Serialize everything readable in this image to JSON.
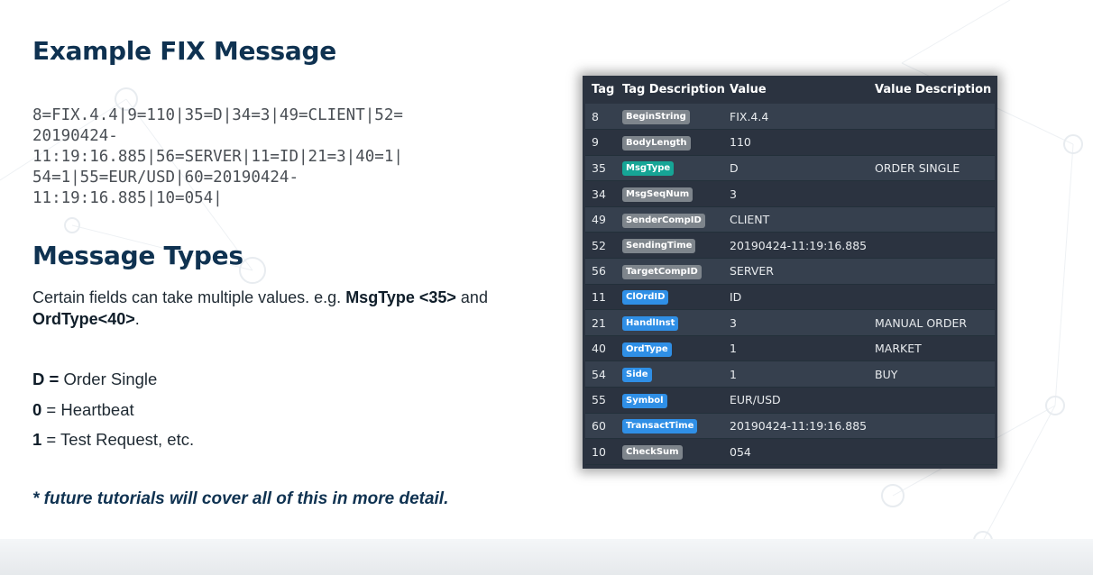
{
  "slide": {
    "title": "Example FIX Message",
    "fix_message_lines": [
      "8=FIX.4.4|9=110|35=D|34=3|49=CLIENT|52=",
      "20190424-",
      "11:19:16.885|56=SERVER|11=ID|21=3|40=1|",
      "54=1|55=EUR/USD|60=20190424-",
      "11:19:16.885|10=054|"
    ],
    "section_title": "Message Types",
    "paragraph": {
      "text1": "Certain fields can take multiple values. e.g. ",
      "bold1": "MsgType <35>",
      "text2": " and ",
      "bold2": "OrdType<40>",
      "text3": "."
    },
    "message_types": [
      {
        "code": "D =",
        "text": " Order Single"
      },
      {
        "code": "0",
        "text": " = Heartbeat"
      },
      {
        "code": "1",
        "text": " = Test Request, etc."
      }
    ],
    "footnote": "* future tutorials will cover all of this in more detail."
  },
  "table": {
    "headers": [
      "Tag",
      "Tag Description",
      "Value",
      "Value Description"
    ],
    "rows": [
      {
        "tag": "8",
        "desc": "BeginString",
        "badge": "gray",
        "value": "FIX.4.4",
        "value_desc": ""
      },
      {
        "tag": "9",
        "desc": "BodyLength",
        "badge": "gray",
        "value": "110",
        "value_desc": ""
      },
      {
        "tag": "35",
        "desc": "MsgType",
        "badge": "teal",
        "value": "D",
        "value_desc": "ORDER SINGLE"
      },
      {
        "tag": "34",
        "desc": "MsgSeqNum",
        "badge": "gray",
        "value": "3",
        "value_desc": ""
      },
      {
        "tag": "49",
        "desc": "SenderCompID",
        "badge": "gray",
        "value": "CLIENT",
        "value_desc": ""
      },
      {
        "tag": "52",
        "desc": "SendingTime",
        "badge": "gray",
        "value": "20190424-11:19:16.885",
        "value_desc": ""
      },
      {
        "tag": "56",
        "desc": "TargetCompID",
        "badge": "gray",
        "value": "SERVER",
        "value_desc": ""
      },
      {
        "tag": "11",
        "desc": "ClOrdID",
        "badge": "blue",
        "value": "ID",
        "value_desc": ""
      },
      {
        "tag": "21",
        "desc": "HandlInst",
        "badge": "blue",
        "value": "3",
        "value_desc": "MANUAL ORDER"
      },
      {
        "tag": "40",
        "desc": "OrdType",
        "badge": "blue",
        "value": "1",
        "value_desc": "MARKET"
      },
      {
        "tag": "54",
        "desc": "Side",
        "badge": "blue",
        "value": "1",
        "value_desc": "BUY"
      },
      {
        "tag": "55",
        "desc": "Symbol",
        "badge": "blue",
        "value": "EUR/USD",
        "value_desc": ""
      },
      {
        "tag": "60",
        "desc": "TransactTime",
        "badge": "blue",
        "value": "20190424-11:19:16.885",
        "value_desc": ""
      },
      {
        "tag": "10",
        "desc": "CheckSum",
        "badge": "gray",
        "value": "054",
        "value_desc": ""
      }
    ]
  },
  "colors": {
    "title": "#0f3251",
    "table_bg": "#2b3340",
    "badge_gray": "#7e858c",
    "badge_teal": "#16a596",
    "badge_blue": "#2f8fe6"
  }
}
